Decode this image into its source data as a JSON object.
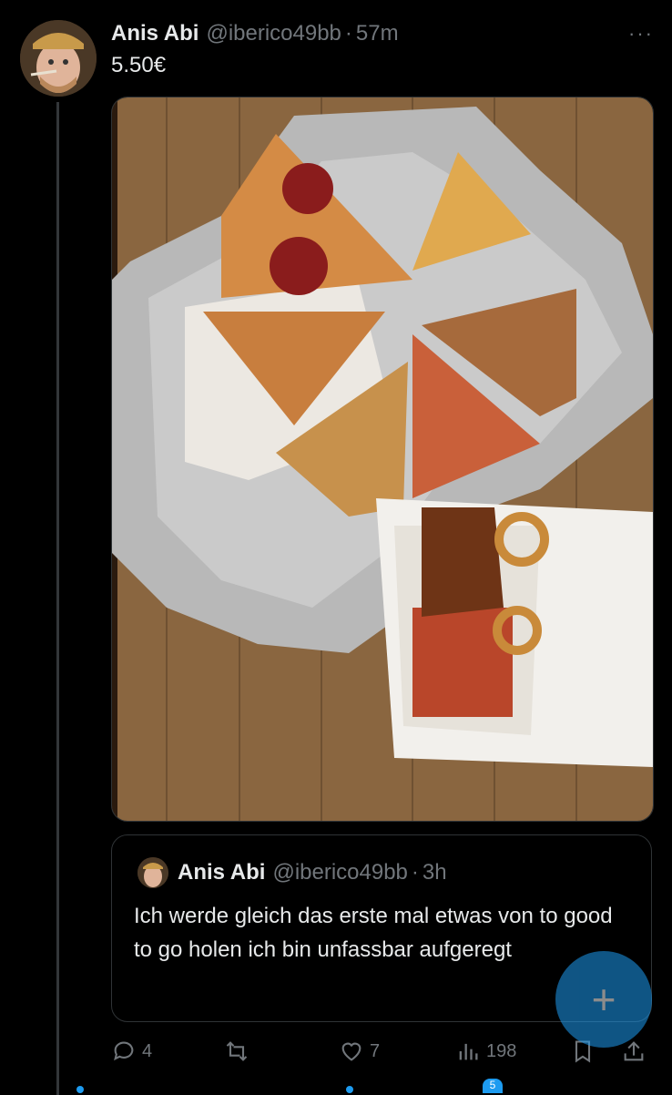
{
  "tweet": {
    "author_name": "Anis Abi",
    "handle": "@iberico49bb",
    "separator": "·",
    "time": "57m",
    "text": "5.50€",
    "more_label": "···"
  },
  "quoted": {
    "author_name": "Anis Abi",
    "handle": "@iberico49bb",
    "separator": "·",
    "time": "3h",
    "text": "Ich werde gleich das erste mal etwas von to good to go holen ich bin unfassbar aufgeregt"
  },
  "actions": {
    "replies": "4",
    "likes": "7",
    "views": "198"
  },
  "fab": {
    "label": "+"
  },
  "nav": {
    "badge": "5"
  },
  "colors": {
    "accent": "#1d9bf0",
    "text": "#e7e9ea",
    "muted": "#71767b",
    "border": "#2f3336"
  },
  "icons": [
    "more-icon",
    "reply-icon",
    "retweet-icon",
    "like-icon",
    "views-icon",
    "bookmark-icon",
    "share-icon",
    "compose-icon"
  ]
}
